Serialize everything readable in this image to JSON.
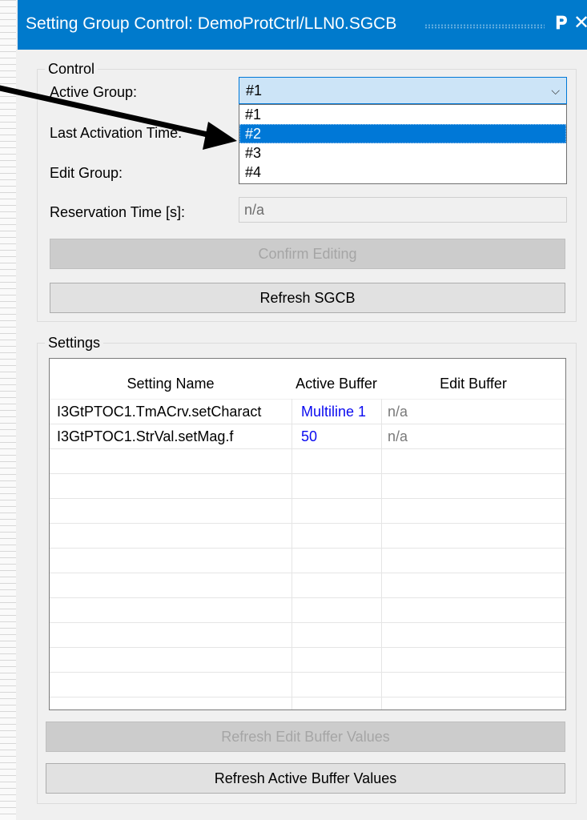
{
  "window": {
    "title": "Setting Group Control: DemoProtCtrl/LLN0.SGCB",
    "pin_icon": "pin-icon",
    "close_icon": "close-icon"
  },
  "control": {
    "legend": "Control",
    "active_group_label": "Active Group:",
    "active_group_value": "#1",
    "active_group_options": [
      "#1",
      "#2",
      "#3",
      "#4"
    ],
    "highlighted_option": "#2",
    "last_activation_label": "Last Activation Time:",
    "edit_group_label": "Edit Group:",
    "reservation_label": "Reservation Time [s]:",
    "reservation_value": "n/a",
    "confirm_button": "Confirm Editing",
    "refresh_sgcb_button": "Refresh SGCB"
  },
  "settings": {
    "legend": "Settings",
    "columns": [
      "Setting Name",
      "Active Buffer",
      "Edit Buffer"
    ],
    "rows": [
      {
        "name": "I3GtPTOC1.TmACrv.setCharact",
        "active": "Multiline 1",
        "edit": "n/a"
      },
      {
        "name": "I3GtPTOC1.StrVal.setMag.f",
        "active": "50",
        "edit": "n/a"
      }
    ],
    "refresh_edit_button": "Refresh Edit Buffer Values",
    "refresh_active_button": "Refresh Active Buffer Values"
  },
  "colors": {
    "titlebar": "#007acc",
    "selection": "#0078d7",
    "active_value": "#0a0af0"
  }
}
